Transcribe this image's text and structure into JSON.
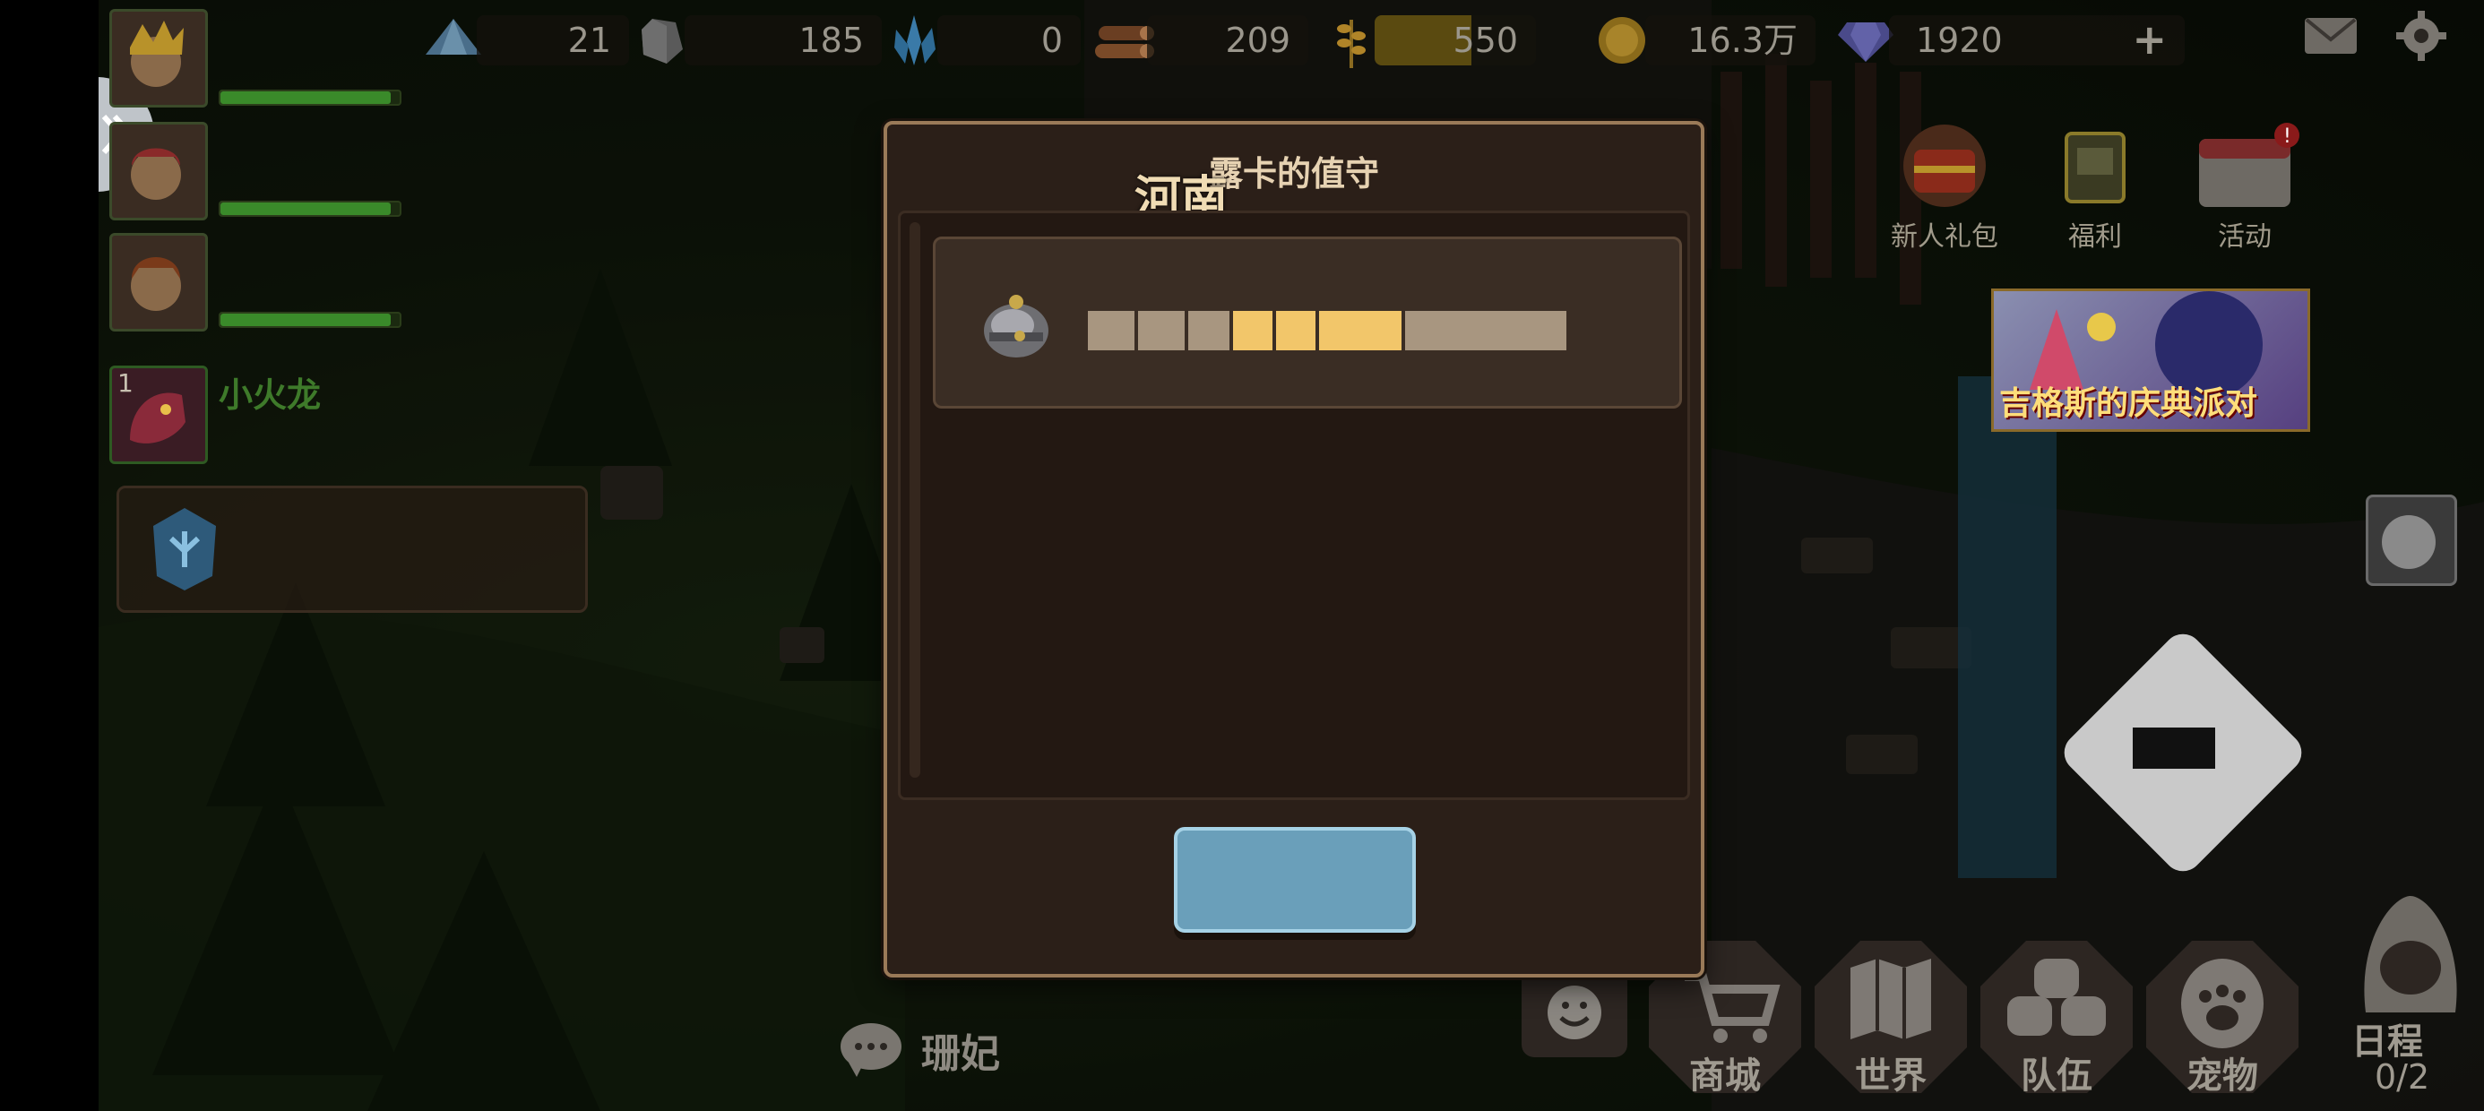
{
  "resources": [
    {
      "name": "stone-ore",
      "value": "21"
    },
    {
      "name": "iron-ore",
      "value": "185"
    },
    {
      "name": "crystal",
      "value": "0"
    },
    {
      "name": "wood",
      "value": "209"
    },
    {
      "name": "wheat",
      "value": "550"
    },
    {
      "name": "gold-coin",
      "value": "16.3万"
    },
    {
      "name": "diamond",
      "value": "1920"
    }
  ],
  "party": {
    "pet_level": "1",
    "pet_name": "小火龙",
    "hp_levels": [
      0.95,
      0.95,
      0.95
    ]
  },
  "right_menu": {
    "gift_label": "新人礼包",
    "welfare_label": "福利",
    "activity_label": "活动",
    "banner_text": "吉格斯的庆典派对"
  },
  "dialog": {
    "title": "露卡的值守",
    "stamp": "河南",
    "item_blocks": [
      {
        "color": "#a89680",
        "w": 52
      },
      {
        "color": "#a89680",
        "w": 52
      },
      {
        "color": "#a89680",
        "w": 46
      },
      {
        "color": "#f2c66a",
        "w": 44
      },
      {
        "color": "#f2c66a",
        "w": 44
      },
      {
        "color": "#f2c66a",
        "w": 92
      },
      {
        "color": "#a89680",
        "w": 180
      }
    ],
    "confirm_label": ""
  },
  "bottom_bar": {
    "shop": "商城",
    "world": "世界",
    "team": "队伍",
    "pet": "宠物",
    "schedule": "日程",
    "schedule_count": "0/2"
  },
  "chat": {
    "name": "珊妃"
  },
  "colors": {
    "dialog_bg": "#2b1f18",
    "dialog_border": "#9a7a58",
    "confirm_button": "#6a9fba",
    "highlight": "#f2c66a"
  }
}
